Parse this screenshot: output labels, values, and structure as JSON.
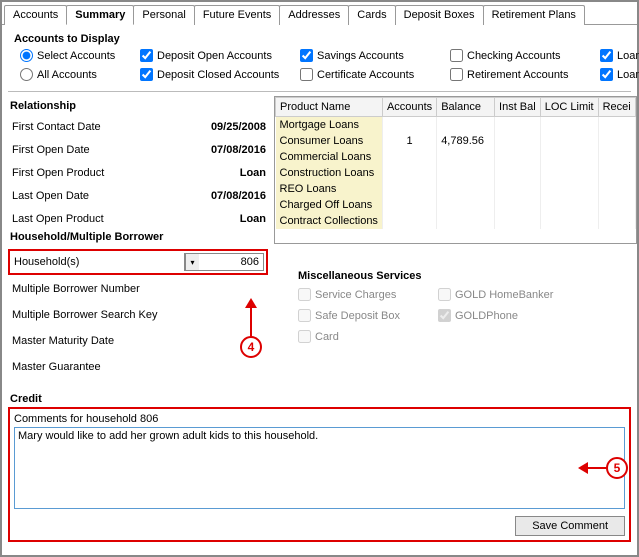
{
  "tabs": {
    "items": [
      "Accounts",
      "Summary",
      "Personal",
      "Future Events",
      "Addresses",
      "Cards",
      "Deposit Boxes",
      "Retirement Plans"
    ],
    "active": "Summary"
  },
  "accountsDisplay": {
    "title": "Accounts to Display",
    "radios": {
      "select": "Select Accounts",
      "all": "All Accounts"
    },
    "checks": {
      "depositOpen": "Deposit Open Accounts",
      "depositClosed": "Deposit Closed Accounts",
      "savings": "Savings Accounts",
      "certificate": "Certificate Accounts",
      "checking": "Checking Accounts",
      "retirement": "Retirement Accounts",
      "loanOpen": "Loan Open A",
      "loanClosed": "Loan Closed"
    }
  },
  "relationship": {
    "title": "Relationship",
    "rows": {
      "firstContactDate": {
        "label": "First Contact Date",
        "value": "09/25/2008"
      },
      "firstOpenDate": {
        "label": "First Open Date",
        "value": "07/08/2016"
      },
      "firstOpenProduct": {
        "label": "First Open Product",
        "value": "Loan"
      },
      "lastOpenDate": {
        "label": "Last Open Date",
        "value": "07/08/2016"
      },
      "lastOpenProduct": {
        "label": "Last Open Product",
        "value": "Loan"
      }
    }
  },
  "household": {
    "title": "Household/Multiple Borrower",
    "householdLabel": "Household(s)",
    "householdValue": "806",
    "rows": {
      "multiBorrowerNumber": "Multiple Borrower Number",
      "multiBorrowerSearch": "Multiple Borrower Search Key",
      "masterMaturity": "Master Maturity Date",
      "masterGuarantee": "Master Guarantee"
    }
  },
  "productTable": {
    "headers": [
      "Product Name",
      "Accounts",
      "Balance",
      "Inst Bal",
      "LOC Limit",
      "Recei"
    ],
    "rows": [
      {
        "name": "Mortgage Loans",
        "accounts": "",
        "balance": ""
      },
      {
        "name": "Consumer Loans",
        "accounts": "1",
        "balance": "4,789.56"
      },
      {
        "name": "Commercial Loans",
        "accounts": "",
        "balance": ""
      },
      {
        "name": "Construction Loans",
        "accounts": "",
        "balance": ""
      },
      {
        "name": "REO Loans",
        "accounts": "",
        "balance": ""
      },
      {
        "name": "Charged Off Loans",
        "accounts": "",
        "balance": ""
      },
      {
        "name": "Contract Collections",
        "accounts": "",
        "balance": ""
      }
    ]
  },
  "misc": {
    "title": "Miscellaneous Services",
    "items": {
      "serviceCharges": "Service Charges",
      "goldHomeBanker": "GOLD HomeBanker",
      "safeDeposit": "Safe Deposit Box",
      "goldPhone": "GOLDPhone",
      "card": "Card"
    }
  },
  "credit": {
    "title": "Credit",
    "commentsLabel": "Comments for household 806",
    "commentValue": "Mary would like to add her grown adult kids to this household.",
    "saveLabel": "Save Comment"
  },
  "callouts": {
    "four": "4",
    "five": "5"
  }
}
